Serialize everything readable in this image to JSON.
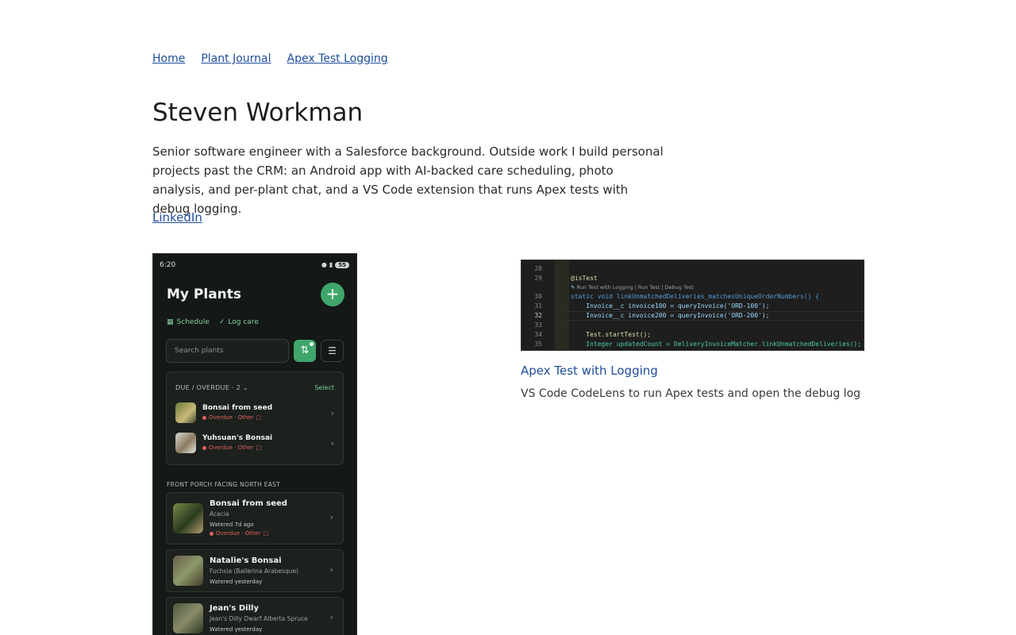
{
  "breadcrumb": [
    {
      "label": "Home"
    },
    {
      "label": "Plant Journal"
    },
    {
      "label": "Apex Test Logging"
    }
  ],
  "profile": {
    "name": "Steven Workman",
    "bio": "Senior software engineer with a Salesforce background. Outside work I build personal projects past the CRM: an Android app with AI-backed care scheduling, photo analysis, and per-plant chat, and a VS Code extension that runs Apex tests with debug logging.",
    "linkedin_label": "LinkedIn"
  },
  "phone_app": {
    "time": "6:20",
    "battery": "55",
    "title": "My Plants",
    "add_icon": "plus-icon",
    "chips": [
      "Schedule",
      "Log care"
    ],
    "search_placeholder": "Search plants",
    "due_section": {
      "header": "DUE / OVERDUE · 2",
      "action": "Select",
      "items": [
        {
          "name": "Bonsai from seed",
          "status": "Overdue · Other"
        },
        {
          "name": "Yuhsuan's Bonsai",
          "status": "Overdue · Other"
        }
      ]
    },
    "location_header": "FRONT PORCH FACING NORTH EAST",
    "plants": [
      {
        "name": "Bonsai from seed",
        "species": "Acacia",
        "watered": "Watered 7d ago",
        "status": "Overdue · Other"
      },
      {
        "name": "Natalie's Bonsai",
        "species": "Fuchsia (Ballerina Arabesque)",
        "watered": "Watered yesterday",
        "status": ""
      },
      {
        "name": "Jean's Dilly",
        "species": "Jean's Dilly Dwarf Alberta Spruce",
        "watered": "Watered yesterday",
        "status": ""
      }
    ]
  },
  "code_shot": {
    "lines": [
      {
        "n": "28",
        "text": ""
      },
      {
        "n": "29",
        "text": "@isTest"
      },
      {
        "n": "30",
        "text": "static void linkUnmatchedDeliveries_matchesUniqueOrderNumbers() {"
      },
      {
        "n": "31",
        "text": "    Invoice__c invoice100 = queryInvoice('ORD-100');"
      },
      {
        "n": "32",
        "text": "    Invoice__c invoice200 = queryInvoice('ORD-200');"
      },
      {
        "n": "33",
        "text": ""
      },
      {
        "n": "34",
        "text": "    Test.startTest();"
      },
      {
        "n": "35",
        "text": "    Integer updatedCount = DeliveryInvoiceMatcher.linkUnmatchedDeliveries();"
      }
    ],
    "codelens": "Run Test with Logging | Run Test | Debug Test"
  },
  "project": {
    "title": "Apex Test with Logging",
    "description": "VS Code CodeLens to run Apex tests and open the debug log"
  }
}
